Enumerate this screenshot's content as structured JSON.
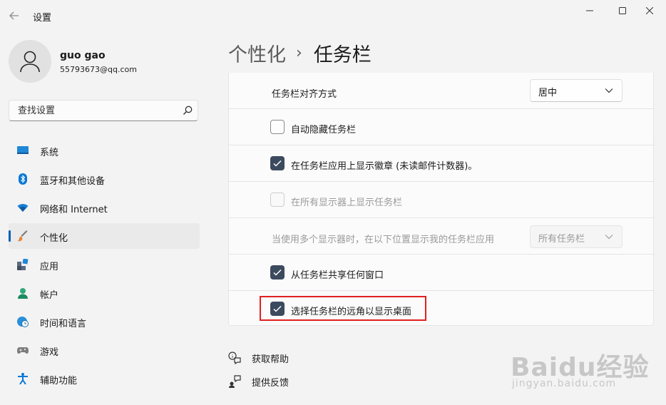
{
  "window": {
    "title": "设置",
    "back_icon": "back-arrow-icon",
    "controls": [
      "minimize-icon",
      "maximize-icon",
      "close-icon"
    ]
  },
  "profile": {
    "name": "guo gao",
    "email": "55793673@qq.com"
  },
  "search": {
    "placeholder": "查找设置"
  },
  "nav": {
    "items": [
      {
        "label": "系统",
        "icon": "system-icon"
      },
      {
        "label": "蓝牙和其他设备",
        "icon": "bluetooth-icon"
      },
      {
        "label": "网络和 Internet",
        "icon": "wifi-icon"
      },
      {
        "label": "个性化",
        "icon": "brush-icon",
        "active": true
      },
      {
        "label": "应用",
        "icon": "apps-icon"
      },
      {
        "label": "帐户",
        "icon": "account-icon"
      },
      {
        "label": "时间和语言",
        "icon": "globe-clock-icon"
      },
      {
        "label": "游戏",
        "icon": "gamepad-icon"
      },
      {
        "label": "辅助功能",
        "icon": "accessibility-icon"
      }
    ]
  },
  "header": {
    "parent": "个性化",
    "separator": "›",
    "current": "任务栏"
  },
  "settings": {
    "alignment": {
      "label": "任务栏对齐方式",
      "value": "居中"
    },
    "auto_hide": {
      "label": "自动隐藏任务栏",
      "checked": false
    },
    "badges": {
      "label": "在任务栏应用上显示徽章 (未读邮件计数器)。",
      "checked": true
    },
    "all_displays": {
      "label": "在所有显示器上显示任务栏",
      "checked": false,
      "disabled": true
    },
    "multi_display": {
      "label": "当使用多个显示器时，在以下位置显示我的任务栏应用",
      "value": "所有任务栏",
      "disabled": true
    },
    "share_window": {
      "label": "从任务栏共享任何窗口",
      "checked": true
    },
    "corner_desktop": {
      "label": "选择任务栏的远角以显示桌面",
      "checked": true,
      "highlighted": true
    }
  },
  "footer": {
    "help": {
      "label": "获取帮助",
      "icon": "help-chat-icon"
    },
    "feedback": {
      "label": "提供反馈",
      "icon": "feedback-icon"
    }
  },
  "watermark": {
    "main": "Baidu经验",
    "sub": "jingyan.baidu.com"
  },
  "colors": {
    "accent": "#005fb8",
    "checkbox_checked": "#3c4a5e",
    "highlight": "#e02020"
  }
}
